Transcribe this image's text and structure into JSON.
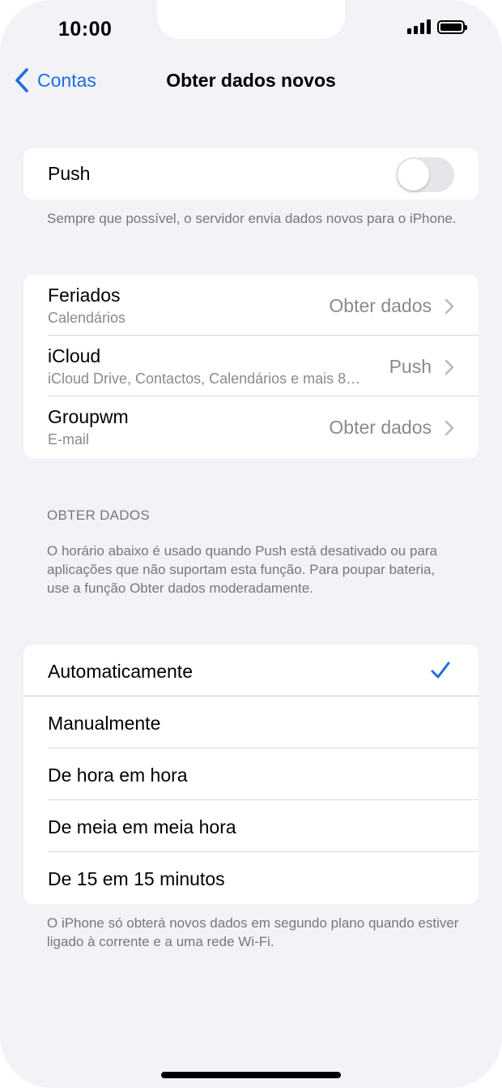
{
  "status_bar": {
    "time": "10:00"
  },
  "nav": {
    "back_label": "Contas",
    "title": "Obter dados novos"
  },
  "push": {
    "label": "Push",
    "enabled": false,
    "footnote": "Sempre que possível, o servidor envia dados novos para o iPhone."
  },
  "accounts": [
    {
      "name": "Feriados",
      "detail": "Calendários",
      "value": "Obter dados"
    },
    {
      "name": "iCloud",
      "detail": "iCloud Drive, Contactos, Calendários e mais 8…",
      "value": "Push"
    },
    {
      "name": "Groupwm",
      "detail": "E-mail",
      "value": "Obter dados"
    }
  ],
  "fetch_section": {
    "header": "OBTER DADOS",
    "description": "O horário abaixo é usado quando Push está desativado ou para aplicações que não suportam esta função. Para poupar bateria, use a função Obter dados moderadamente."
  },
  "schedule_options": [
    {
      "label": "Automaticamente",
      "selected": true
    },
    {
      "label": "Manualmente",
      "selected": false
    },
    {
      "label": "De hora em hora",
      "selected": false
    },
    {
      "label": "De meia em meia hora",
      "selected": false
    },
    {
      "label": "De 15 em 15 minutos",
      "selected": false
    }
  ],
  "bottom_footnote": "O iPhone só obterá novos dados em segundo plano quando estiver ligado à corrente e a uma rede Wi-Fi.",
  "colors": {
    "accent": "#1b6fe0",
    "background": "#f2f2f7",
    "secondary_text": "#8a8a8e"
  }
}
